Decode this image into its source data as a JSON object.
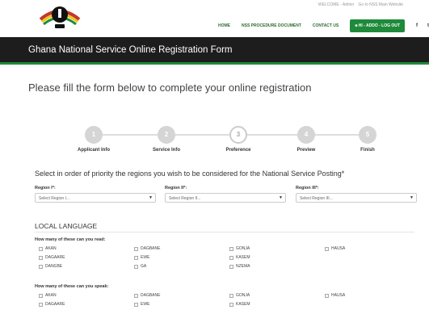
{
  "topbar": {
    "welcome": "WELCOME - Admin",
    "goto": "Go to NSS Main Website"
  },
  "nav": {
    "home": "HOME",
    "procedure": "NSS PROCEDURE DOCUMENT",
    "contact": "CONTACT US",
    "logout": "HI - ADDO - LOG OUT",
    "facebook": "f",
    "twitter": "t"
  },
  "banner": {
    "title": "Ghana National Service Online Registration Form"
  },
  "lead": "Please fill the form below to complete your online registration",
  "steps": [
    {
      "num": "1",
      "label": "Applicant Info"
    },
    {
      "num": "2",
      "label": "Service Info"
    },
    {
      "num": "3",
      "label": "Preference"
    },
    {
      "num": "4",
      "label": "Preview"
    },
    {
      "num": "5",
      "label": "Finish"
    }
  ],
  "instruction": "Select in order of priority the regions you wish to be considered for the National Service Posting*",
  "regions": [
    {
      "label": "Region I*:",
      "placeholder": "Select Region I..."
    },
    {
      "label": "Region II*:",
      "placeholder": "Select Region II..."
    },
    {
      "label": "Region III*:",
      "placeholder": "Select Region III..."
    }
  ],
  "local_language": {
    "title": "LOCAL LANGUAGE",
    "read_question": "How many of these can you read:",
    "speak_question": "How many of these can you speak:",
    "read_options": [
      "AKAN",
      "DAGBANE",
      "GONJA",
      "HAUSA",
      "DAGAARE",
      "EWE",
      "KASEM",
      "DANGBE",
      "GA",
      "NZEMA"
    ],
    "speak_options": [
      "AKAN",
      "DAGBANE",
      "GONJA",
      "HAUSA",
      "DAGAARE",
      "EWE",
      "KASEM"
    ]
  }
}
